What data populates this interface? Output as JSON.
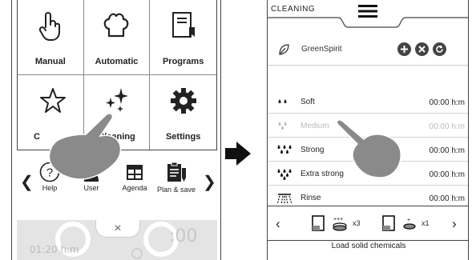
{
  "left_screen": {
    "tiles": [
      {
        "label": "Manual",
        "icon": "hand-pointer-icon"
      },
      {
        "label": "Automatic",
        "icon": "chef-hat-icon"
      },
      {
        "label": "Programs",
        "icon": "book-bookmark-icon"
      },
      {
        "label": "C",
        "icon": "star-icon"
      },
      {
        "label": "Cleaning",
        "icon": "sparkle-icon"
      },
      {
        "label": "Settings",
        "icon": "gear-icon"
      }
    ],
    "nav_items": [
      {
        "label": "Help",
        "icon": "help-icon"
      },
      {
        "label": "User",
        "icon": "user-icon"
      },
      {
        "label": "Agenda",
        "icon": "agenda-icon"
      },
      {
        "label": "Plan & save",
        "icon": "clipboard-icon"
      }
    ],
    "close_symbol": "×",
    "ghost_time": "01:20 h:m",
    "ghost_clock": ":00"
  },
  "right_screen": {
    "title": "CLEANING",
    "green_spirit": {
      "label": "GreenSpirit",
      "icon": "leaf-icon"
    },
    "programs": [
      {
        "name": "Soft",
        "time": "00:00 h:m",
        "enabled": true
      },
      {
        "name": "Medium",
        "time": "00:00 h:m",
        "enabled": false
      },
      {
        "name": "Strong",
        "time": "00:00 h:m",
        "enabled": true
      },
      {
        "name": "Extra strong",
        "time": "00:00 h:m",
        "enabled": true
      },
      {
        "name": "Rinse",
        "time": "00:00 h:m",
        "enabled": true
      }
    ],
    "chemicals": [
      {
        "qty": "x3"
      },
      {
        "qty": "x1"
      }
    ],
    "chem_caption": "Load solid chemicals",
    "prev": "‹",
    "next": "›"
  },
  "colors": {
    "frame": "#444444",
    "hand": "#8a8a8a",
    "ghost": "#e4e4e4"
  }
}
